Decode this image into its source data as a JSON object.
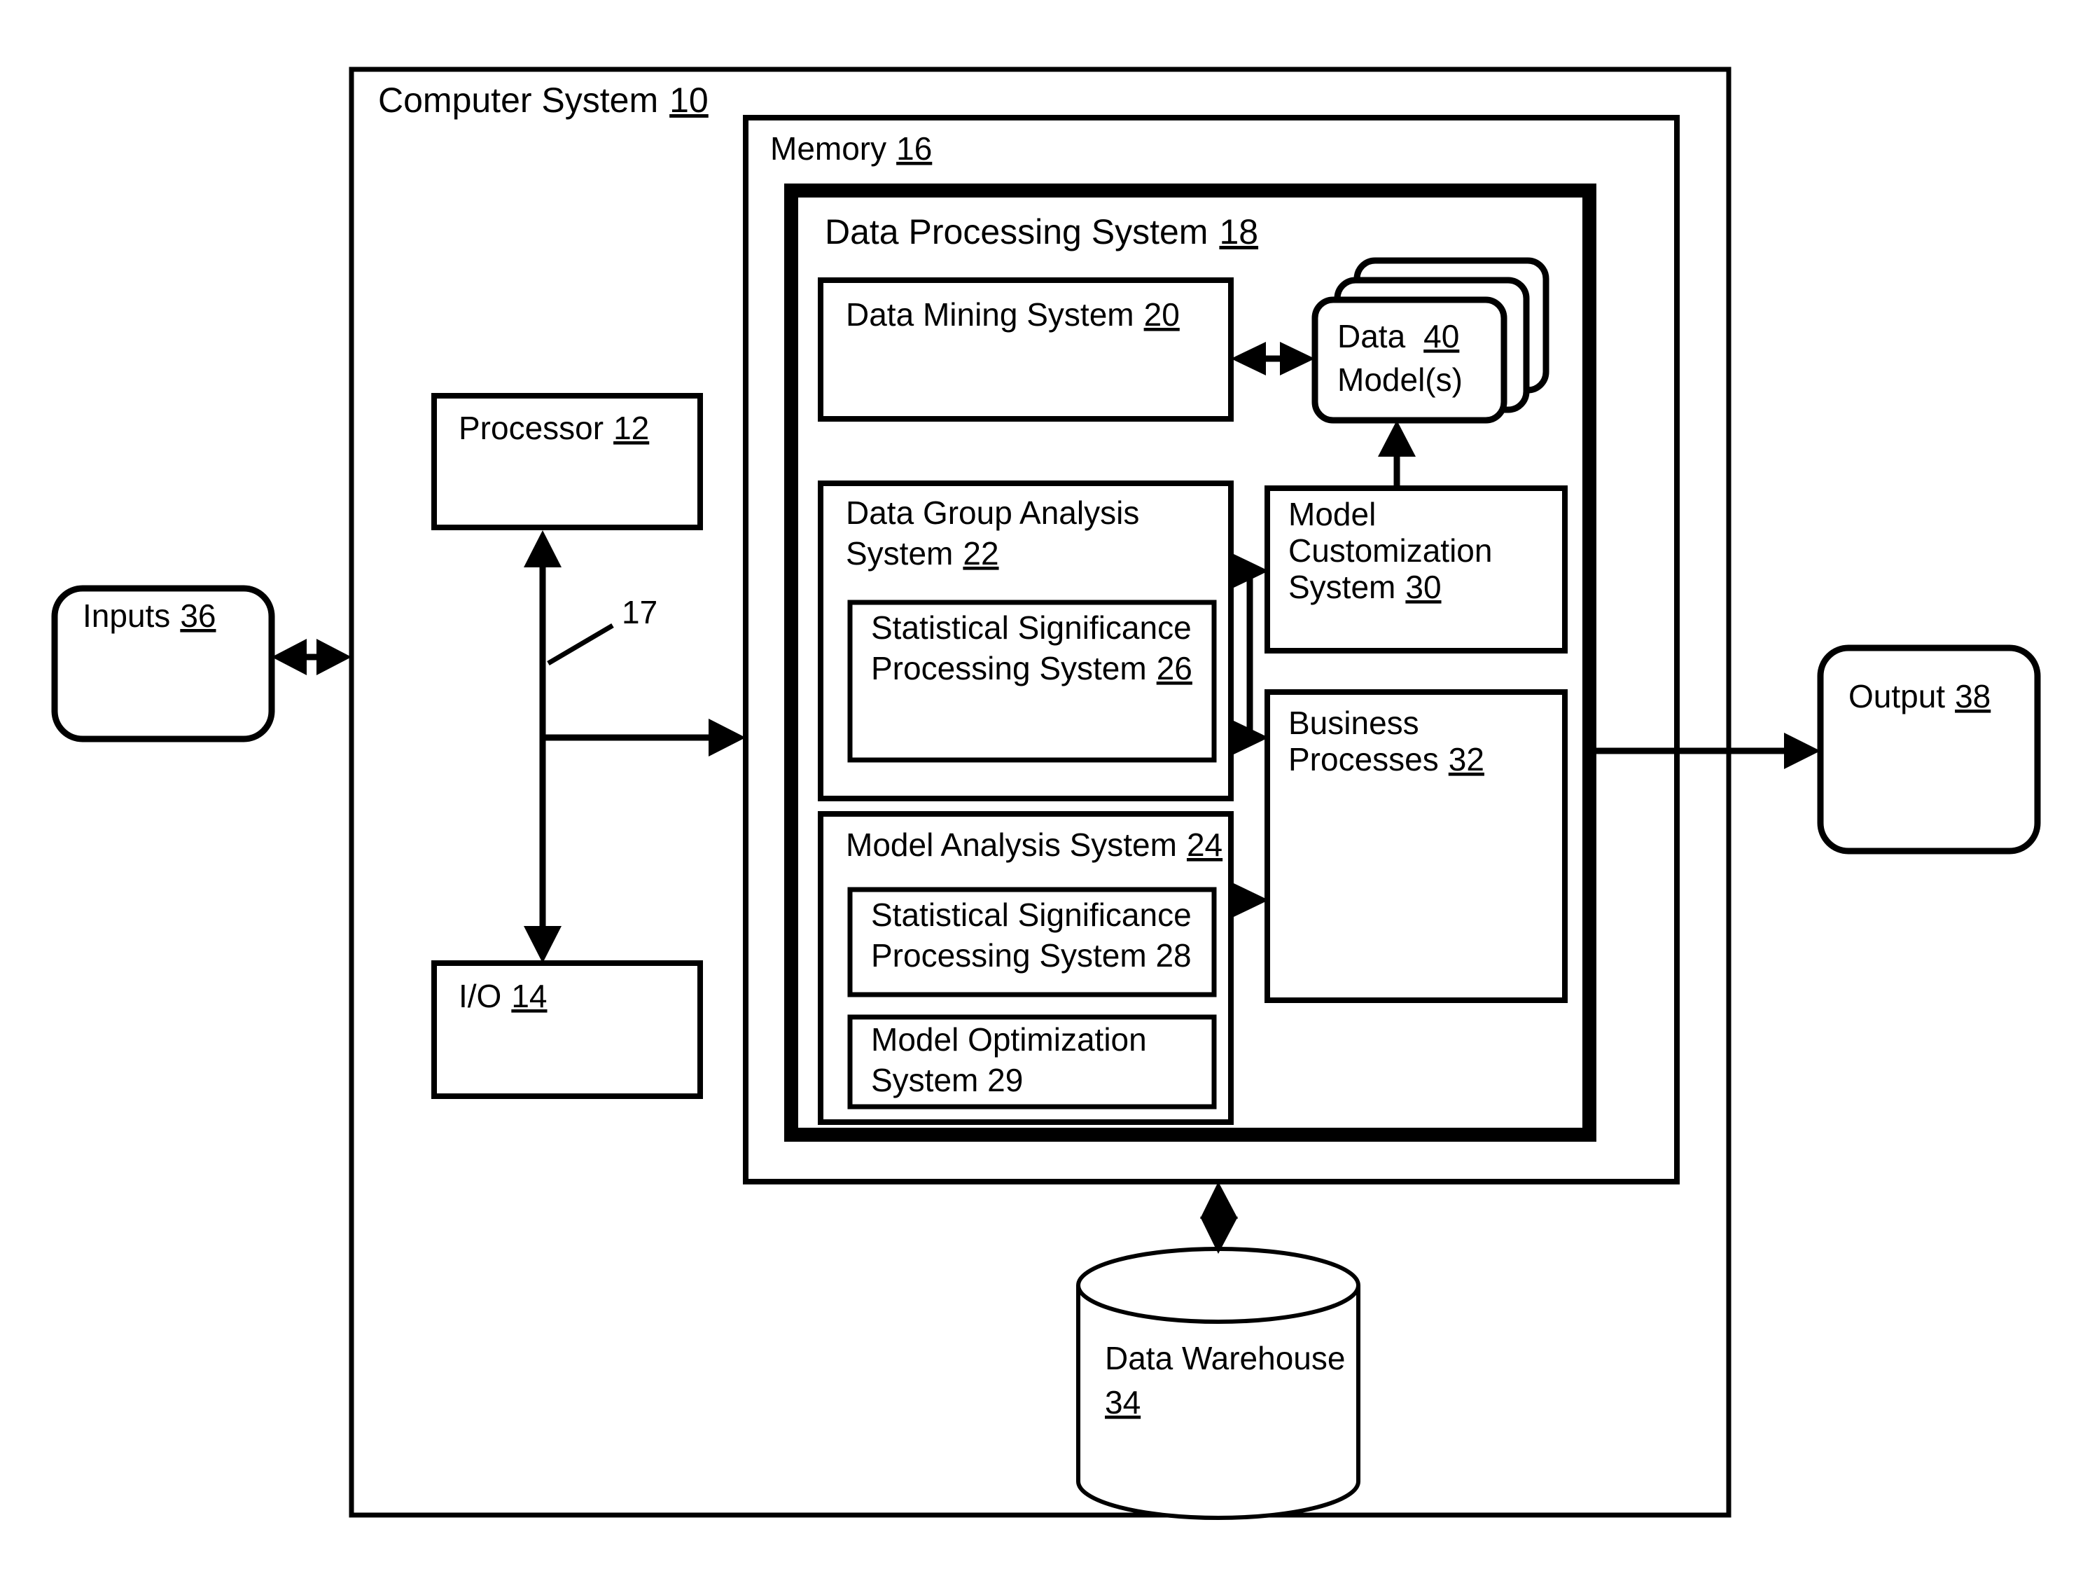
{
  "figure": {
    "type": "patent-block-diagram",
    "background_color": "#ffffff",
    "line_color": "#000000"
  },
  "blocks": {
    "computer_system": {
      "label": "Computer System",
      "ref": "10"
    },
    "memory": {
      "label": "Memory",
      "ref": "16"
    },
    "data_processing_system": {
      "label": "Data Processing System",
      "ref": "18"
    },
    "data_mining_system": {
      "label": "Data Mining System",
      "ref": "20"
    },
    "data_models": {
      "label_line1": "Data",
      "label_line2": "Model(s)",
      "ref": "40"
    },
    "data_group_analysis_system": {
      "label_line1": "Data Group Analysis",
      "label_line2": "System",
      "ref": "22"
    },
    "statistical_significance_26": {
      "label_line1": "Statistical Significance",
      "label_line2": "Processing System",
      "ref": "26"
    },
    "model_analysis_system": {
      "label": "Model Analysis System",
      "ref": "24"
    },
    "statistical_significance_28": {
      "label_line1": "Statistical Significance",
      "label_line2": "Processing System 28",
      "ref": "28"
    },
    "model_optimization_system": {
      "label_line1": "Model Optimization",
      "label_line2": "System 29",
      "ref": "29"
    },
    "model_customization_system": {
      "label_line1": "Model",
      "label_line2": "Customization",
      "label_line3": "System",
      "ref": "30"
    },
    "business_processes": {
      "label_line1": "Business",
      "label_line2": "Processes",
      "ref": "32"
    },
    "data_warehouse": {
      "label_line1": "Data Warehouse",
      "label_line2": "34",
      "ref": "34"
    },
    "processor": {
      "label": "Processor",
      "ref": "12"
    },
    "io": {
      "label": "I/O",
      "ref": "14"
    },
    "inputs": {
      "label": "Inputs",
      "ref": "36"
    },
    "output": {
      "label": "Output",
      "ref": "38"
    },
    "bus": {
      "ref": "17"
    }
  },
  "connections": [
    {
      "from": "inputs",
      "to": "computer_system",
      "style": "double-arrow"
    },
    {
      "from": "processor",
      "to": "io",
      "style": "double-arrow-vertical",
      "ref": "17"
    },
    {
      "from": "bus",
      "to": "memory",
      "style": "arrow-right"
    },
    {
      "from": "data_mining_system",
      "to": "data_models",
      "style": "double-arrow"
    },
    {
      "from": "model_customization_system",
      "to": "data_models",
      "style": "arrow-up"
    },
    {
      "from": "data_group_analysis_system",
      "to": "model_customization_system",
      "style": "arrow-right"
    },
    {
      "from": "data_group_analysis_system",
      "to": "business_processes",
      "style": "arrow-right"
    },
    {
      "from": "model_analysis_system",
      "to": "business_processes",
      "style": "arrow-right"
    },
    {
      "from": "data_processing_system",
      "to": "output",
      "style": "arrow-right"
    },
    {
      "from": "memory",
      "to": "data_warehouse",
      "style": "double-arrow-vertical"
    }
  ]
}
